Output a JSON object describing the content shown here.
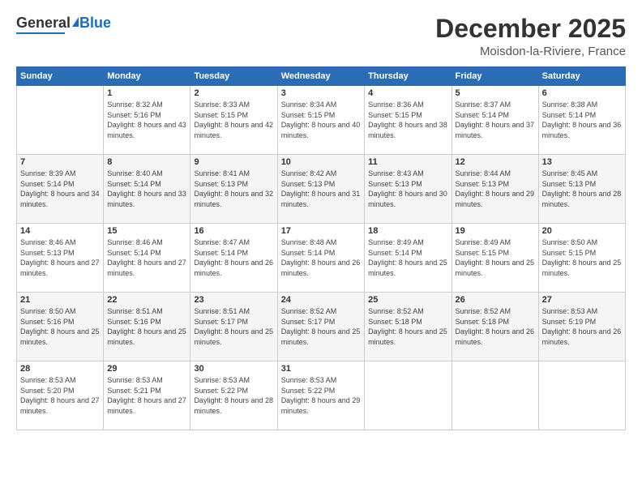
{
  "logo": {
    "general": "General",
    "blue": "Blue"
  },
  "header": {
    "month": "December 2025",
    "location": "Moisdon-la-Riviere, France"
  },
  "days_of_week": [
    "Sunday",
    "Monday",
    "Tuesday",
    "Wednesday",
    "Thursday",
    "Friday",
    "Saturday"
  ],
  "weeks": [
    [
      {
        "day": "",
        "sunrise": "",
        "sunset": "",
        "daylight": ""
      },
      {
        "day": "1",
        "sunrise": "Sunrise: 8:32 AM",
        "sunset": "Sunset: 5:16 PM",
        "daylight": "Daylight: 8 hours and 43 minutes."
      },
      {
        "day": "2",
        "sunrise": "Sunrise: 8:33 AM",
        "sunset": "Sunset: 5:15 PM",
        "daylight": "Daylight: 8 hours and 42 minutes."
      },
      {
        "day": "3",
        "sunrise": "Sunrise: 8:34 AM",
        "sunset": "Sunset: 5:15 PM",
        "daylight": "Daylight: 8 hours and 40 minutes."
      },
      {
        "day": "4",
        "sunrise": "Sunrise: 8:36 AM",
        "sunset": "Sunset: 5:15 PM",
        "daylight": "Daylight: 8 hours and 38 minutes."
      },
      {
        "day": "5",
        "sunrise": "Sunrise: 8:37 AM",
        "sunset": "Sunset: 5:14 PM",
        "daylight": "Daylight: 8 hours and 37 minutes."
      },
      {
        "day": "6",
        "sunrise": "Sunrise: 8:38 AM",
        "sunset": "Sunset: 5:14 PM",
        "daylight": "Daylight: 8 hours and 36 minutes."
      }
    ],
    [
      {
        "day": "7",
        "sunrise": "Sunrise: 8:39 AM",
        "sunset": "Sunset: 5:14 PM",
        "daylight": "Daylight: 8 hours and 34 minutes."
      },
      {
        "day": "8",
        "sunrise": "Sunrise: 8:40 AM",
        "sunset": "Sunset: 5:14 PM",
        "daylight": "Daylight: 8 hours and 33 minutes."
      },
      {
        "day": "9",
        "sunrise": "Sunrise: 8:41 AM",
        "sunset": "Sunset: 5:13 PM",
        "daylight": "Daylight: 8 hours and 32 minutes."
      },
      {
        "day": "10",
        "sunrise": "Sunrise: 8:42 AM",
        "sunset": "Sunset: 5:13 PM",
        "daylight": "Daylight: 8 hours and 31 minutes."
      },
      {
        "day": "11",
        "sunrise": "Sunrise: 8:43 AM",
        "sunset": "Sunset: 5:13 PM",
        "daylight": "Daylight: 8 hours and 30 minutes."
      },
      {
        "day": "12",
        "sunrise": "Sunrise: 8:44 AM",
        "sunset": "Sunset: 5:13 PM",
        "daylight": "Daylight: 8 hours and 29 minutes."
      },
      {
        "day": "13",
        "sunrise": "Sunrise: 8:45 AM",
        "sunset": "Sunset: 5:13 PM",
        "daylight": "Daylight: 8 hours and 28 minutes."
      }
    ],
    [
      {
        "day": "14",
        "sunrise": "Sunrise: 8:46 AM",
        "sunset": "Sunset: 5:13 PM",
        "daylight": "Daylight: 8 hours and 27 minutes."
      },
      {
        "day": "15",
        "sunrise": "Sunrise: 8:46 AM",
        "sunset": "Sunset: 5:14 PM",
        "daylight": "Daylight: 8 hours and 27 minutes."
      },
      {
        "day": "16",
        "sunrise": "Sunrise: 8:47 AM",
        "sunset": "Sunset: 5:14 PM",
        "daylight": "Daylight: 8 hours and 26 minutes."
      },
      {
        "day": "17",
        "sunrise": "Sunrise: 8:48 AM",
        "sunset": "Sunset: 5:14 PM",
        "daylight": "Daylight: 8 hours and 26 minutes."
      },
      {
        "day": "18",
        "sunrise": "Sunrise: 8:49 AM",
        "sunset": "Sunset: 5:14 PM",
        "daylight": "Daylight: 8 hours and 25 minutes."
      },
      {
        "day": "19",
        "sunrise": "Sunrise: 8:49 AM",
        "sunset": "Sunset: 5:15 PM",
        "daylight": "Daylight: 8 hours and 25 minutes."
      },
      {
        "day": "20",
        "sunrise": "Sunrise: 8:50 AM",
        "sunset": "Sunset: 5:15 PM",
        "daylight": "Daylight: 8 hours and 25 minutes."
      }
    ],
    [
      {
        "day": "21",
        "sunrise": "Sunrise: 8:50 AM",
        "sunset": "Sunset: 5:16 PM",
        "daylight": "Daylight: 8 hours and 25 minutes."
      },
      {
        "day": "22",
        "sunrise": "Sunrise: 8:51 AM",
        "sunset": "Sunset: 5:16 PM",
        "daylight": "Daylight: 8 hours and 25 minutes."
      },
      {
        "day": "23",
        "sunrise": "Sunrise: 8:51 AM",
        "sunset": "Sunset: 5:17 PM",
        "daylight": "Daylight: 8 hours and 25 minutes."
      },
      {
        "day": "24",
        "sunrise": "Sunrise: 8:52 AM",
        "sunset": "Sunset: 5:17 PM",
        "daylight": "Daylight: 8 hours and 25 minutes."
      },
      {
        "day": "25",
        "sunrise": "Sunrise: 8:52 AM",
        "sunset": "Sunset: 5:18 PM",
        "daylight": "Daylight: 8 hours and 25 minutes."
      },
      {
        "day": "26",
        "sunrise": "Sunrise: 8:52 AM",
        "sunset": "Sunset: 5:18 PM",
        "daylight": "Daylight: 8 hours and 26 minutes."
      },
      {
        "day": "27",
        "sunrise": "Sunrise: 8:53 AM",
        "sunset": "Sunset: 5:19 PM",
        "daylight": "Daylight: 8 hours and 26 minutes."
      }
    ],
    [
      {
        "day": "28",
        "sunrise": "Sunrise: 8:53 AM",
        "sunset": "Sunset: 5:20 PM",
        "daylight": "Daylight: 8 hours and 27 minutes."
      },
      {
        "day": "29",
        "sunrise": "Sunrise: 8:53 AM",
        "sunset": "Sunset: 5:21 PM",
        "daylight": "Daylight: 8 hours and 27 minutes."
      },
      {
        "day": "30",
        "sunrise": "Sunrise: 8:53 AM",
        "sunset": "Sunset: 5:22 PM",
        "daylight": "Daylight: 8 hours and 28 minutes."
      },
      {
        "day": "31",
        "sunrise": "Sunrise: 8:53 AM",
        "sunset": "Sunset: 5:22 PM",
        "daylight": "Daylight: 8 hours and 29 minutes."
      },
      {
        "day": "",
        "sunrise": "",
        "sunset": "",
        "daylight": ""
      },
      {
        "day": "",
        "sunrise": "",
        "sunset": "",
        "daylight": ""
      },
      {
        "day": "",
        "sunrise": "",
        "sunset": "",
        "daylight": ""
      }
    ]
  ]
}
